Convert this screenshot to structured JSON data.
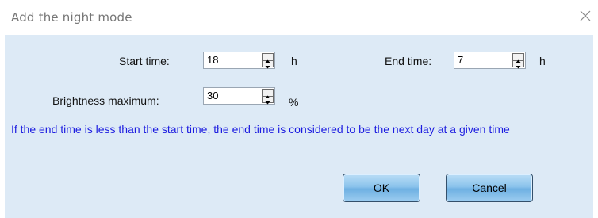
{
  "dialog": {
    "title": "Add the night mode"
  },
  "form": {
    "start_time_label": "Start time:",
    "start_time_value": "18",
    "start_time_unit": "h",
    "end_time_label": "End time:",
    "end_time_value": "7",
    "end_time_unit": "h",
    "brightness_label": "Brightness maximum:",
    "brightness_value": "30",
    "brightness_unit": "%"
  },
  "note": "If the end time is less than the start time, the end time is considered to be the next day at a given time",
  "buttons": {
    "ok_label": "OK",
    "cancel_label": "Cancel"
  },
  "icons": {
    "close": "close-icon",
    "spin_up": "spin-up-arrow-icon",
    "spin_down": "spin-down-arrow-icon"
  },
  "colors": {
    "body_background": "#ddeaf6",
    "note_text": "#1c1ce0",
    "button_fill": "#8cc4ec"
  }
}
